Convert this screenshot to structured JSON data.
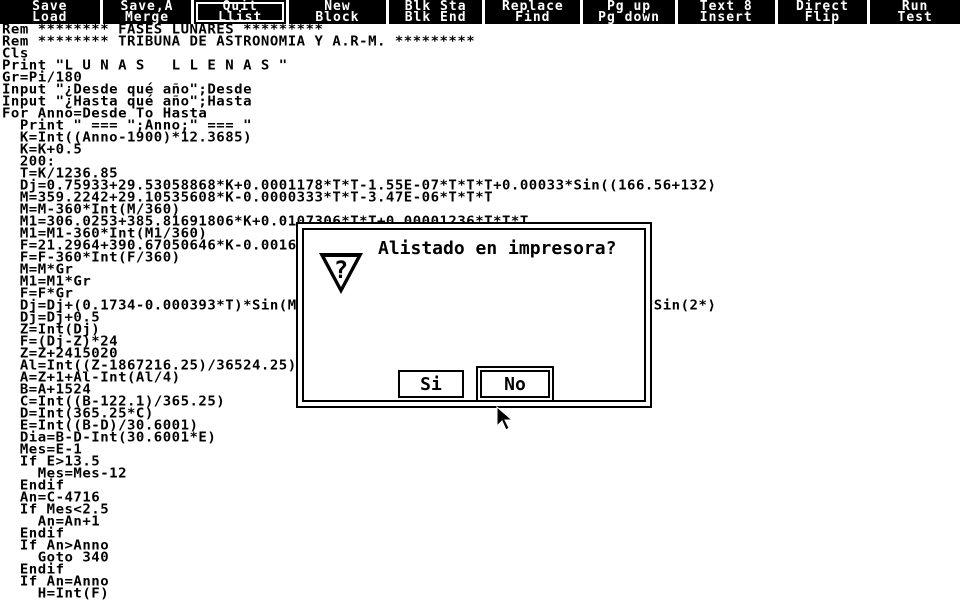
{
  "function_keys": [
    {
      "top": "Save",
      "bottom": "Load",
      "width": 100
    },
    {
      "top": "Save,A",
      "bottom": "Merge",
      "width": 89
    },
    {
      "top": "Quit",
      "bottom": "Llist",
      "width": 92,
      "active": true
    },
    {
      "top": "New",
      "bottom": "Block",
      "width": 97
    },
    {
      "top": "Blk Sta",
      "bottom": "Blk End",
      "width": 94
    },
    {
      "top": "Replace",
      "bottom": "Find",
      "width": 95
    },
    {
      "top": "Pg up",
      "bottom": "Pg down",
      "width": 92
    },
    {
      "top": "Text 8",
      "bottom": "Insert",
      "width": 97
    },
    {
      "top": "Direct",
      "bottom": "Flip",
      "width": 90
    },
    {
      "top": "Run",
      "bottom": "Test",
      "width": 90
    }
  ],
  "code_lines": [
    "Rem ******** FASES LUNARES *********",
    "Rem ******** TRIBUNA DE ASTRONOMIA Y A.R-M. *********",
    "Cls",
    "Print \"L U N A S   L L E N A S \"",
    "Gr=Pi/180",
    "Input \"¿Desde qué año\";Desde",
    "Input \"¿Hasta qué año\";Hasta",
    "For Anno=Desde To Hasta",
    "  Print \" === \";Anno;\" === \"",
    "  K=Int((Anno-1900)*12.3685)",
    "  K=K+0.5",
    "  200:",
    "  T=K/1236.85",
    "  Dj=0.75933+29.53058868*K+0.0001178*T*T-1.55E-07*T*T*T+0.00033*Sin((166.56+132⟩",
    "  M=359.2242+29.10535608*K-0.0000333*T*T-3.47E-06*T*T*T",
    "  M=M-360*Int(M/360)",
    "  M1=306.0253+385.81691806*K+0.0107306*T*T+0.00001236*T*T*T",
    "  M1=M1-360*Int(M1/360)",
    "  F=21.2964+390.67050646*K-0.0016528*T*T-0.00000239*T*T*T",
    "  F=F-360*Int(F/360)",
    "  M=M*Gr",
    "  M1=M1*Gr",
    "  F=F*Gr",
    "  Dj=Dj+(0.1734-0.000393*T)*Sin(M)+0.0021*Sin(2*M)-0.4068*Sin(M1)+0.0161*Sin(2*⟩",
    "  Dj=Dj+0.5",
    "  Z=Int(Dj)",
    "  F=(Dj-Z)*24",
    "  Z=Z+2415020",
    "  Al=Int((Z-1867216.25)/36524.25)",
    "  A=Z+1+Al-Int(Al/4)",
    "  B=A+1524",
    "  C=Int((B-122.1)/365.25)",
    "  D=Int(365.25*C)",
    "  E=Int((B-D)/30.6001)",
    "  Dia=B-D-Int(30.6001*E)",
    "  Mes=E-1",
    "  If E>13.5",
    "    Mes=Mes-12",
    "  Endif",
    "  An=C-4716",
    "  If Mes<2.5",
    "    An=An+1",
    "  Endif",
    "  If An>Anno",
    "    Goto 340",
    "  Endif",
    "  If An=Anno",
    "    H=Int(F)"
  ],
  "dialog": {
    "title": "Alistado en impresora?",
    "icon": "question-warning-icon",
    "yes_label": "Si",
    "no_label": "No"
  },
  "colors": {
    "background": "#ffffff",
    "foreground": "#000000"
  }
}
